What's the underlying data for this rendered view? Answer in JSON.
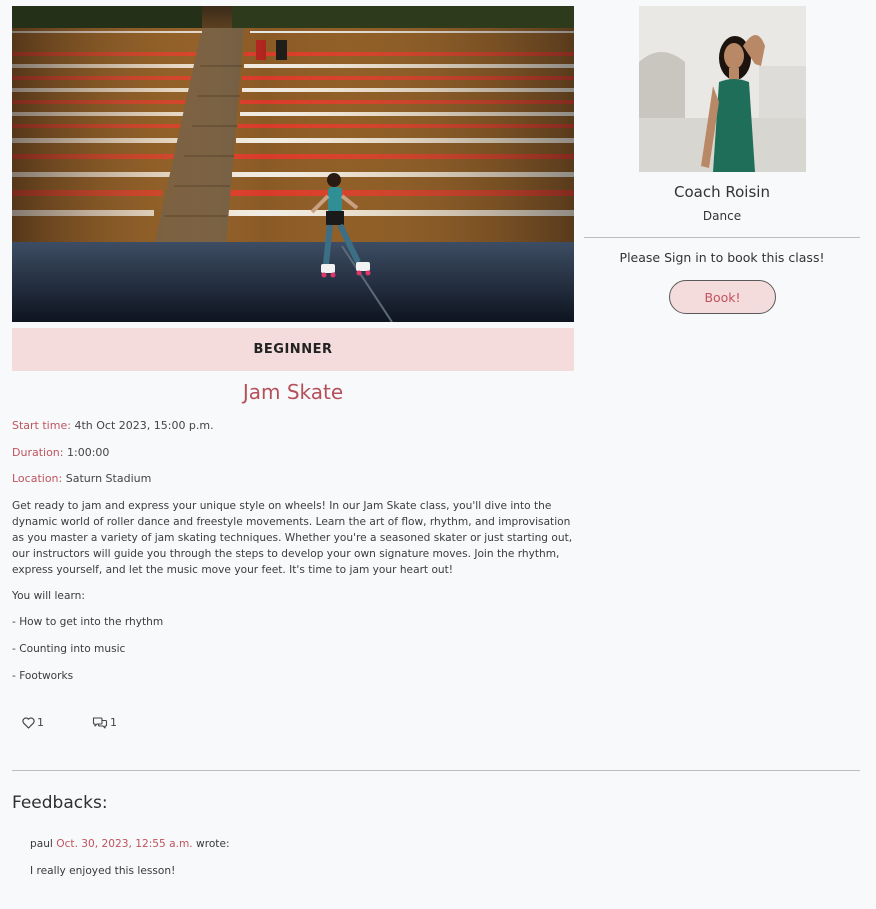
{
  "class": {
    "level": "BEGINNER",
    "title": "Jam Skate",
    "start_time": {
      "label": "Start time",
      "value": "4th Oct 2023, 15:00 p.m."
    },
    "duration": {
      "label": "Duration",
      "value": "1:00:00"
    },
    "location": {
      "label": "Location",
      "value": "Saturn Stadium"
    },
    "description": "Get ready to jam and express your unique style on wheels! In our Jam Skate class, you'll dive into the dynamic world of roller dance and freestyle movements. Learn the art of flow, rhythm, and improvisation as you master a variety of jam skating techniques. Whether you're a seasoned skater or just starting out, our instructors will guide you through the steps to develop your own signature moves. Join the rhythm, express yourself, and let the music move your feet. It's time to jam your heart out!",
    "learn_heading": "You will learn:",
    "learn_items": [
      "- How to get into the rhythm",
      "- Counting into music",
      "- Footworks"
    ],
    "likes": "1",
    "comments": "1"
  },
  "coach": {
    "name": "Coach Roisin",
    "specialty": "Dance",
    "signin_message": "Please Sign in to book this class!",
    "book_label": "Book!"
  },
  "feedbacks": {
    "heading": "Feedbacks:",
    "items": [
      {
        "user": "paul",
        "date": "Oct. 30, 2023, 12:55 a.m.",
        "suffix": "wrote:",
        "text": "I really enjoyed this lesson!"
      }
    ]
  },
  "icons": {
    "like": "heart-icon",
    "comment": "comments-icon"
  },
  "colors": {
    "accent": "#c0545e",
    "banner": "#f4dcdd",
    "background": "#f8f9fb"
  }
}
